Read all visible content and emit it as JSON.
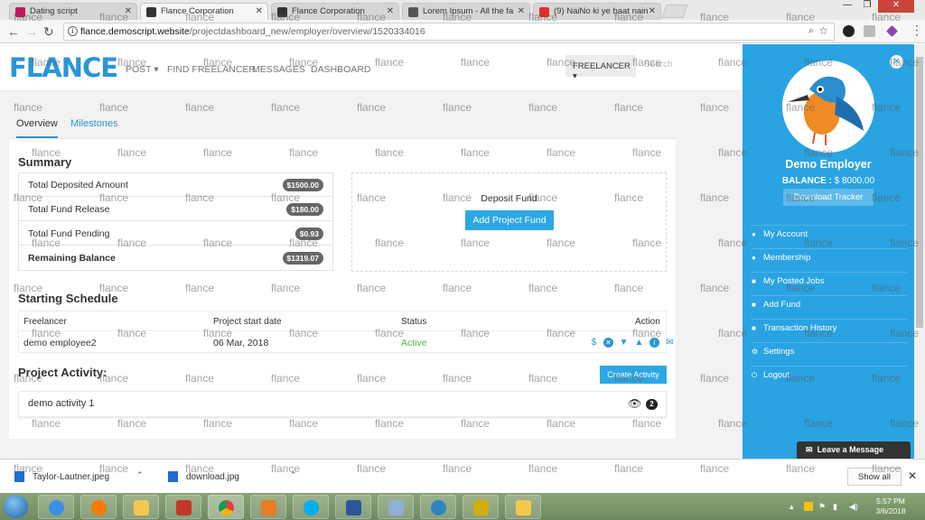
{
  "browser": {
    "tabs": [
      {
        "title": "Dating script",
        "favicon_color": "#c2185b"
      },
      {
        "title": "Flance Corporation",
        "favicon_color": "#333333",
        "active": true
      },
      {
        "title": "Flance Corporation",
        "favicon_color": "#333333"
      },
      {
        "title": "Lorem Ipsum - All the fa",
        "favicon_color": "#555555"
      },
      {
        "title": "(9) NaiNo ki ye baat nain",
        "favicon_color": "#e52d27"
      }
    ],
    "url_host": "flance.demoscript.website",
    "url_path": "/projectdashboard_new/employer/overview/1520334016"
  },
  "site": {
    "logo": "FLANCE",
    "nav": [
      "POST",
      "FIND FREELANCER",
      "MESSAGES",
      "DASHBOARD"
    ],
    "freelancer_dropdown": "FREELANCER",
    "search_placeholder": "Search"
  },
  "tabs": {
    "overview": "Overview",
    "milestones": "Milestones"
  },
  "summary": {
    "title": "Summary",
    "rows": [
      {
        "label": "Total Deposited Amount",
        "value": "$1500.00"
      },
      {
        "label": "Total Fund Release",
        "value": "$180.00"
      },
      {
        "label": "Total Fund Pending",
        "value": "$0.93"
      },
      {
        "label": "Remaining Balance",
        "value": "$1319.07"
      }
    ],
    "deposit_title": "Deposit Fund",
    "add_fund_button": "Add Project Fund"
  },
  "schedule": {
    "title": "Starting Schedule",
    "headers": [
      "Freelancer",
      "Project start date",
      "Status",
      "Action"
    ],
    "row": {
      "freelancer": "demo employee2",
      "start_date": "06 Mar, 2018",
      "status": "Active"
    }
  },
  "activity": {
    "title": "Project Activity:",
    "create_button": "Create Activity",
    "item": "demo activity 1",
    "count": "2"
  },
  "sidebar": {
    "name": "Demo Employer",
    "balance_label": "BALANCE :",
    "balance_value": "$ 8000.00",
    "tracker_button": "Download Tracker",
    "menu": [
      "My Account",
      "Membership",
      "My Posted Jobs",
      "Add Fund",
      "Transaction History",
      "Settings",
      "Logout"
    ],
    "chat_button": "Leave a Message",
    "accent": "#2aa3e3"
  },
  "downloads": {
    "files": [
      "Taylor-Lautner.jpeg",
      "download.jpg"
    ],
    "show_all": "Show all"
  },
  "taskbar": {
    "time": "5:57 PM",
    "date": "3/6/2018"
  },
  "watermark": "flance"
}
